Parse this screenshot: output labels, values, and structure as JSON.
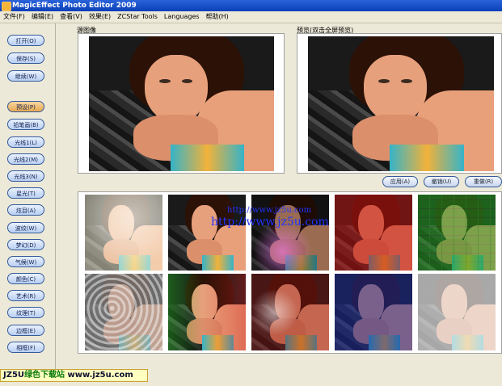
{
  "window": {
    "title": "MagicEffect Photo Editor 2009"
  },
  "menu": [
    "文件(F)",
    "编辑(E)",
    "查看(V)",
    "效果(E)",
    "ZCStar Tools",
    "Languages",
    "帮助(H)"
  ],
  "sidebar": {
    "file_buttons": [
      "打开(O)",
      "保存(S)",
      "继续(W)"
    ],
    "effect_buttons": [
      "预设(P)",
      "铅笔画(B)",
      "光线1(L)",
      "光线2(M)",
      "光线3(N)",
      "星光(T)",
      "炫目(A)",
      "波纹(W)",
      "梦幻(D)",
      "气候(W)",
      "颜色(C)",
      "艺术(R)",
      "纹理(T)",
      "边框(E)",
      "相框(F)"
    ]
  },
  "original_label": "源图像",
  "preview_label": "预览(双击全屏预览)",
  "actions": {
    "apply": "应用(A)",
    "undo": "撤销(U)",
    "redo": "重做(R)"
  },
  "watermark": {
    "line1": "http://www.jz5u.com",
    "line2": "http://www.jz5u.com"
  },
  "banner": {
    "prefix": "JZ5U",
    "green": "绿色下载站",
    "suffix": " www.jz5u.com"
  }
}
